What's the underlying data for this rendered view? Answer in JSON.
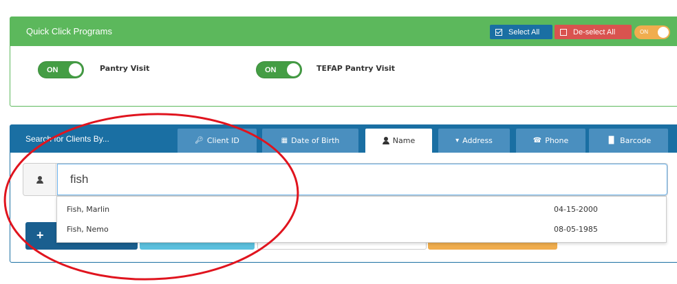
{
  "quick_click": {
    "title": "Quick Click Programs",
    "select_all_label": "Select All",
    "deselect_all_label": "De-select All",
    "master_toggle_label": "ON",
    "programs": [
      {
        "toggle_label": "ON",
        "name": "Pantry Visit"
      },
      {
        "toggle_label": "ON",
        "name": "TEFAP Pantry Visit"
      }
    ]
  },
  "search": {
    "title": "Search for Clients By...",
    "tabs": [
      {
        "label": "Client ID",
        "icon": "key-icon"
      },
      {
        "label": "Date of Birth",
        "icon": "calendar-icon"
      },
      {
        "label": "Name",
        "icon": "user-icon",
        "active": true
      },
      {
        "label": "Address",
        "icon": "map-marker-icon"
      },
      {
        "label": "Phone",
        "icon": "phone-icon"
      },
      {
        "label": "Barcode",
        "icon": "barcode-icon"
      }
    ],
    "input_value": "fish",
    "add_button_label": "+",
    "suggestions": [
      {
        "name": "Fish, Marlin",
        "dob": "04-15-2000"
      },
      {
        "name": "Fish, Nemo",
        "dob": "08-05-1985"
      }
    ]
  },
  "colors": {
    "success": "#5cb85c",
    "primary": "#1a6fa3",
    "danger": "#d9534f",
    "warning": "#f0ad4e",
    "info": "#5bc0de",
    "annotation": "#e0141e"
  }
}
